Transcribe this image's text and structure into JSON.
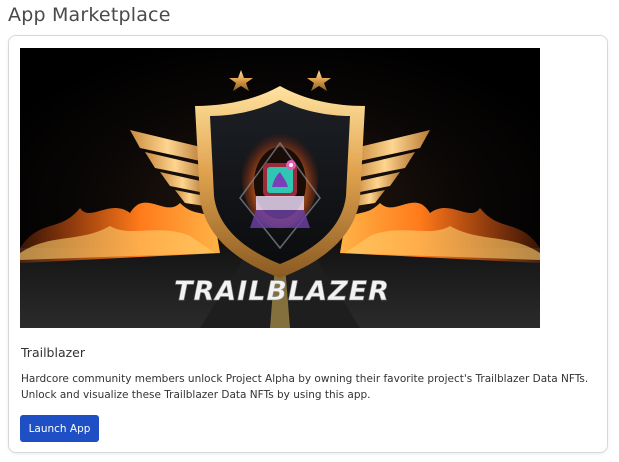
{
  "page": {
    "title": "App Marketplace"
  },
  "app": {
    "banner_text": "TRAILBLAZER",
    "name": "Trailblazer",
    "description": "Hardcore community members unlock Project Alpha by owning their favorite project's Trailblazer Data NFTs. Unlock and visualize these Trailblazer Data NFTs by using this app.",
    "launch_label": "Launch App"
  },
  "colors": {
    "accent": "#1f4fc4",
    "gold": "#e9b15a",
    "fire": "#ff6a1a"
  }
}
